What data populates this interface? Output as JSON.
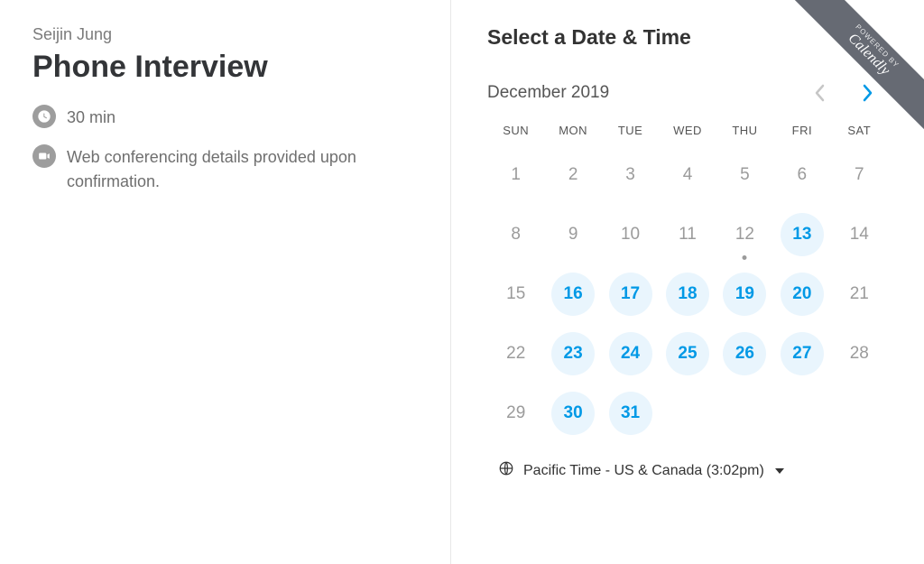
{
  "host": "Seijin Jung",
  "event_title": "Phone Interview",
  "duration": "30 min",
  "location_note": "Web conferencing details provided upon confirmation.",
  "heading": "Select a Date & Time",
  "month_label": "December 2019",
  "weekdays": [
    "SUN",
    "MON",
    "TUE",
    "WED",
    "THU",
    "FRI",
    "SAT"
  ],
  "days": [
    {
      "n": 1,
      "a": false
    },
    {
      "n": 2,
      "a": false
    },
    {
      "n": 3,
      "a": false
    },
    {
      "n": 4,
      "a": false
    },
    {
      "n": 5,
      "a": false
    },
    {
      "n": 6,
      "a": false
    },
    {
      "n": 7,
      "a": false
    },
    {
      "n": 8,
      "a": false
    },
    {
      "n": 9,
      "a": false
    },
    {
      "n": 10,
      "a": false
    },
    {
      "n": 11,
      "a": false
    },
    {
      "n": 12,
      "a": false,
      "today": true
    },
    {
      "n": 13,
      "a": true
    },
    {
      "n": 14,
      "a": false
    },
    {
      "n": 15,
      "a": false
    },
    {
      "n": 16,
      "a": true
    },
    {
      "n": 17,
      "a": true
    },
    {
      "n": 18,
      "a": true
    },
    {
      "n": 19,
      "a": true
    },
    {
      "n": 20,
      "a": true
    },
    {
      "n": 21,
      "a": false
    },
    {
      "n": 22,
      "a": false
    },
    {
      "n": 23,
      "a": true
    },
    {
      "n": 24,
      "a": true
    },
    {
      "n": 25,
      "a": true
    },
    {
      "n": 26,
      "a": true
    },
    {
      "n": 27,
      "a": true
    },
    {
      "n": 28,
      "a": false
    },
    {
      "n": 29,
      "a": false
    },
    {
      "n": 30,
      "a": true
    },
    {
      "n": 31,
      "a": true
    }
  ],
  "timezone": "Pacific Time - US & Canada (3:02pm)",
  "ribbon_small": "POWERED BY",
  "ribbon_brand": "Calendly",
  "colors": {
    "accent": "#0099e6",
    "available_bg": "#e9f5fd",
    "muted": "#9b9b9b"
  }
}
